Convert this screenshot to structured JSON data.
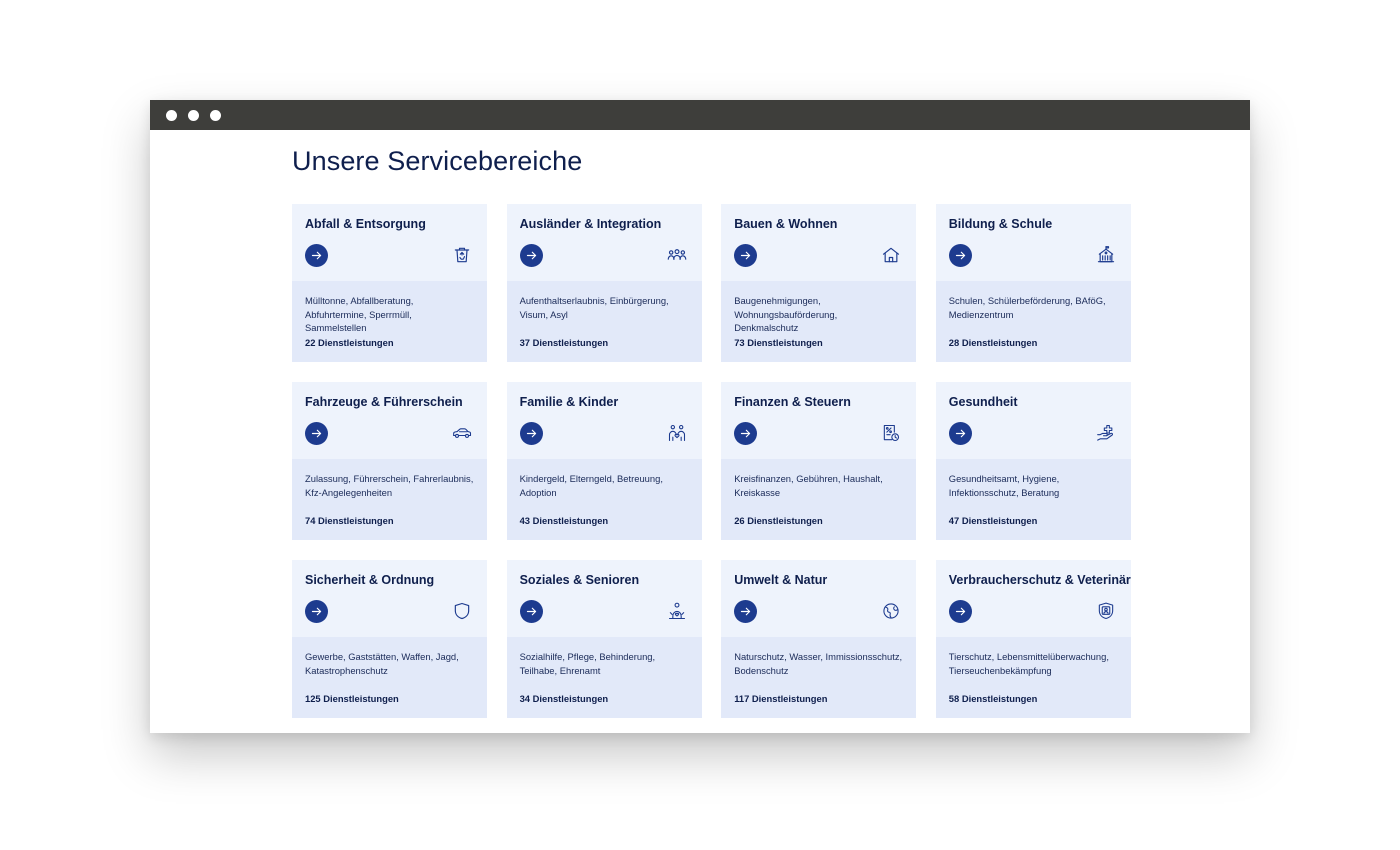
{
  "page": {
    "title": "Unsere Servicebereiche"
  },
  "colors": {
    "titlebar": "#3e3e3b",
    "card_top": "#eef3fc",
    "card_bottom": "#e2e9f9",
    "accent": "#1d3b8f",
    "text_dark": "#0f1f4d"
  },
  "cards": [
    {
      "title": "Abfall & Entsorgung",
      "description": "Mülltonne, Abfallberatung, Abfuhrtermine, Sperrmüll, Sammelstellen",
      "count": "22 Dienstleistungen",
      "icon": "recycle-bin-icon"
    },
    {
      "title": "Ausländer & Integration",
      "description": "Aufenthaltserlaubnis, Einbürgerung, Visum, Asyl",
      "count": "37 Dienstleistungen",
      "icon": "people-group-icon"
    },
    {
      "title": "Bauen & Wohnen",
      "description": "Baugenehmigungen, Wohnungsbauförderung, Denkmalschutz",
      "count": "73 Dienstleistungen",
      "icon": "house-icon"
    },
    {
      "title": "Bildung & Schule",
      "description": "Schulen, Schülerbeförderung, BAföG, Medienzentrum",
      "count": "28 Dienstleistungen",
      "icon": "school-building-icon"
    },
    {
      "title": "Fahrzeuge & Führerschein",
      "description": "Zulassung, Führerschein, Fahrerlaubnis, Kfz-Angelegenheiten",
      "count": "74 Dienstleistungen",
      "icon": "car-icon"
    },
    {
      "title": "Familie & Kinder",
      "description": "Kindergeld, Elterngeld, Betreuung, Adoption",
      "count": "43 Dienstleistungen",
      "icon": "family-icon"
    },
    {
      "title": "Finanzen & Steuern",
      "description": "Kreisfinanzen, Gebühren, Haushalt, Kreiskasse",
      "count": "26 Dienstleistungen",
      "icon": "tax-document-clock-icon"
    },
    {
      "title": "Gesundheit",
      "description": "Gesundheitsamt, Hygiene, Infektionsschutz, Beratung",
      "count": "47 Dienstleistungen",
      "icon": "hand-medical-cross-icon"
    },
    {
      "title": "Sicherheit & Ordnung",
      "description": "Gewerbe, Gaststätten, Waffen, Jagd, Katastrophenschutz",
      "count": "125 Dienstleistungen",
      "icon": "shield-icon"
    },
    {
      "title": "Soziales & Senioren",
      "description": "Sozialhilfe, Pflege, Behinderung, Teilhabe, Ehrenamt",
      "count": "34 Dienstleistungen",
      "icon": "caring-person-icon"
    },
    {
      "title": "Umwelt & Natur",
      "description": "Naturschutz, Wasser, Immissionsschutz, Bodenschutz",
      "count": "117 Dienstleistungen",
      "icon": "globe-leaf-icon"
    },
    {
      "title": "Verbraucherschutz & Veterinär",
      "description": "Tierschutz, Lebensmittelüberwachung, Tierseuchenbekämpfung",
      "count": "58 Dienstleistungen",
      "icon": "shield-person-icon"
    }
  ]
}
